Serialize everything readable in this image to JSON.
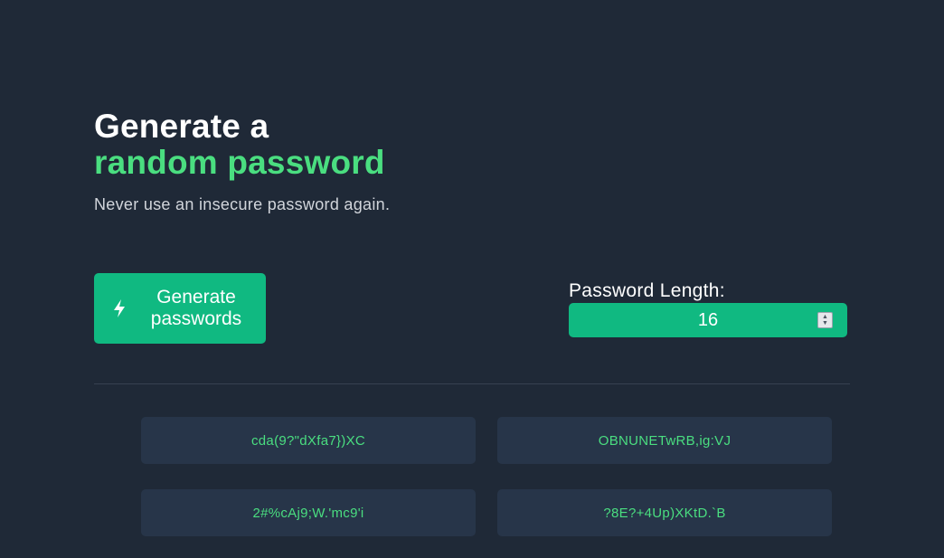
{
  "header": {
    "title_line1": "Generate a",
    "title_line2": "random password",
    "subtitle": "Never use an insecure password again."
  },
  "generate_button": {
    "label": "Generate passwords",
    "icon": "bolt-icon"
  },
  "length": {
    "label": "Password Length:",
    "value": "16"
  },
  "passwords": [
    "cda(9?\"dXfa7})XC",
    "OBNUNETwRB,ig:VJ",
    "2#%cAj9;W.'mc9'i",
    "?8E?+4Up)XKtD.`B"
  ],
  "colors": {
    "background": "#1f2937",
    "accent": "#10b981",
    "accent_text": "#4ade80",
    "card": "#273549"
  }
}
